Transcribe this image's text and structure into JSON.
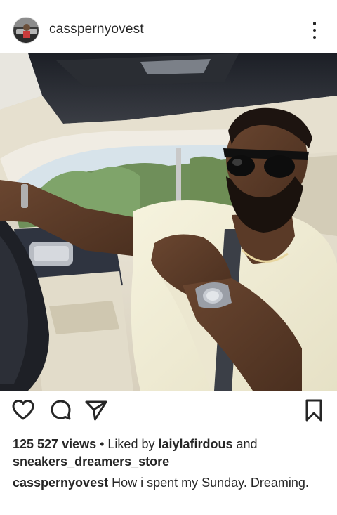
{
  "post": {
    "username": "casspernyovest",
    "views": "125 527 views",
    "separator": " • ",
    "liked_by_prefix": "Liked by ",
    "liked_by_user": "laiylafirdous",
    "and_text": " and",
    "second_user": "sneakers_dreamers_store",
    "caption_user": "casspernyovest",
    "caption_text": " How i spent my Sunday. Dreaming."
  },
  "icons": {
    "avatar": "avatar",
    "more": "more-options-icon",
    "like": "heart-icon",
    "comment": "comment-icon",
    "share": "send-icon",
    "save": "bookmark-icon"
  },
  "colors": {
    "text": "#262626",
    "background": "#ffffff"
  }
}
